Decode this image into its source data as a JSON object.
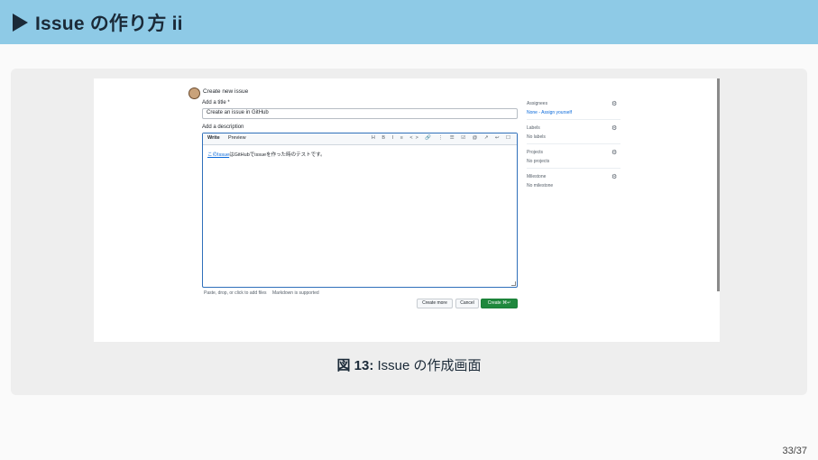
{
  "slide": {
    "title": "Issue の作り方 ii",
    "caption_label": "図 13:",
    "caption_text": " Issue の作成画面",
    "page_number": "33/37"
  },
  "issue_form": {
    "heading": "Create new issue",
    "title_label": "Add a title *",
    "title_value": "Create an issue in GitHub",
    "description_label": "Add a description",
    "tab_write": "Write",
    "tab_preview": "Preview",
    "toolbar_icons": "H B I ≡ <> 🔗 ⋮ ☰ ☑ @ ↗ ↩ ☐",
    "description_prefix": "このIssue",
    "description_body": "はGitHubでissueを作った時のテストです。",
    "attach_hint": "Paste, drop, or click to add files",
    "markdown_hint": "Markdown is supported",
    "create_more_label": "Create more",
    "cancel_label": "Cancel",
    "create_label": "Create ⌘↵",
    "sidebar": [
      {
        "label": "Assignees",
        "value": "None - Assign yourself"
      },
      {
        "label": "Labels",
        "value": "No labels"
      },
      {
        "label": "Projects",
        "value": "No projects"
      },
      {
        "label": "Milestone",
        "value": "No milestone"
      }
    ]
  },
  "colors": {
    "header_bg": "#8ecae6",
    "header_text": "#1b2a38",
    "primary_button": "#1f883d",
    "focus_border": "#2f6fba"
  }
}
